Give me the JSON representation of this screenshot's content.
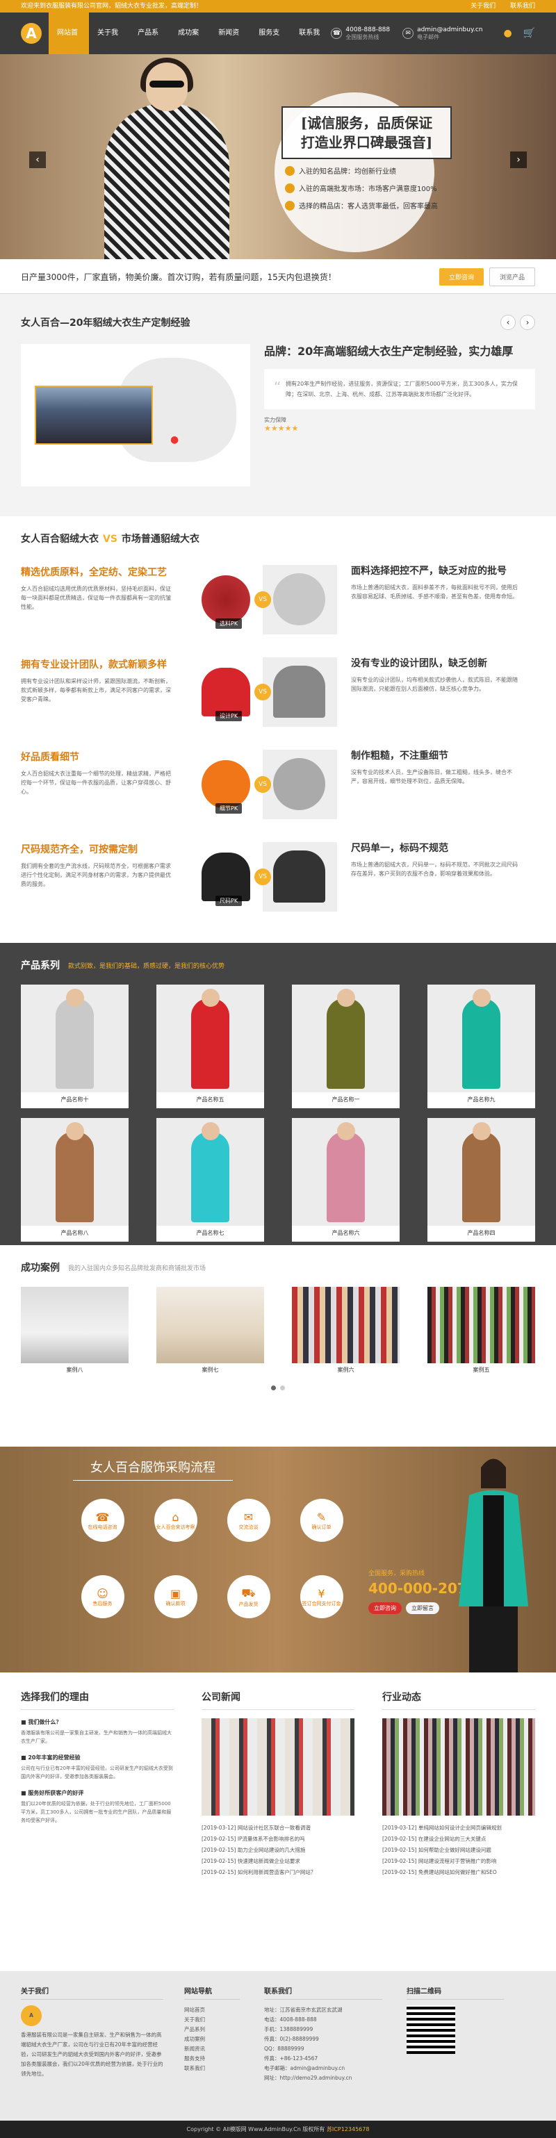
{
  "topbar": {
    "welcome": "欢迎来到衣服服装有限公司官网，貂绒大衣专业批发，高端定制！",
    "links": [
      "关于我们",
      "联系我们"
    ]
  },
  "header": {
    "logo": "A",
    "nav": [
      "网站首页",
      "关于我们",
      "产品系列",
      "成功案例",
      "新闻资讯",
      "服务支持",
      "联系我们"
    ],
    "phone": "4008-888-888",
    "phone_sub": "全国服务热线",
    "email": "admin@adminbuy.cn",
    "email_sub": "电子邮件"
  },
  "banner": {
    "slogan_line1": "[诚信服务，品质保证",
    "slogan_line2": "打造业界口碑最强音]",
    "bullets": [
      "入驻的知名品牌：均创新行业绩",
      "入驻的高端批发市场：市场客户满意度100%",
      "选择的精品店：客人选货率最低，回客率最高"
    ]
  },
  "announce": {
    "text": "日产量3000件，厂家直销，物美价廉。首次订购，若有质量问题，15天内包退换货！",
    "btn1": "立即咨询",
    "btn2": "浏览产品"
  },
  "brand": {
    "title": "女人百合—20年貂绒大衣生产定制经验",
    "heading": "品牌：20年高端貂绒大衣生产定制经验，实力雄厚",
    "quote": "拥有20年生产制作经验，进驻服务，资源保证；工厂面积5000平方米，员工300多人，实力保障；在深圳、北京、上海、杭州、成都、江苏等高端批发市场都广泛化好评。",
    "power": "实力保障",
    "stars": "★★★★★"
  },
  "compare": {
    "title_left": "女人百合貂绒大衣",
    "vs": "VS",
    "title_right": "市场普通貂绒大衣",
    "rows": [
      {
        "lh": "精选优质原料，全定纺、定染工艺",
        "lp": "女人百合貂绒均选用优质的优质原材料，坚持毛织面料，保证每一块面料都是优质精选，保证每一件衣服都具有一定的抗皱性能。",
        "tag": "选料PK",
        "rh": "面料选择把控不严，缺乏对应的批号",
        "rp": "市场上普通的貂绒大衣，面料参差不齐，每批面料批号不同，使用后衣服容易起球、毛质掉绒、手感不顺滑，甚至有色差，使用寿命短。"
      },
      {
        "lh": "拥有专业设计团队，款式新颖多样",
        "lp": "拥有专业设计团队和采样设计师，紧跟国际潮流，不断创新，款式新颖多样，每季都有新款上市，满足不同客户的需求，深受客户青睐。",
        "tag": "设计PK",
        "rh": "没有专业的设计团队，缺乏创新",
        "rp": "没有专业的设计团队，均布相关款式抄袭他人，款式陈旧，不能跟随国际潮流，只能跟在别人后面模仿，缺乏核心竞争力。"
      },
      {
        "lh": "好品质看细节",
        "lp": "女人百合貂绒大衣注重每一个细节的处理，精益求精，严格把控每一个环节，保证每一件衣服的品质，让客户穿得放心、舒心。",
        "tag": "细节PK",
        "rh": "制作粗糙，不注重细节",
        "rp": "没有专业的技术人员，生产设备陈旧，做工粗糙，线头多，缝合不严，容易开线，细节处理不到位，品质无保障。"
      },
      {
        "lh": "尺码规范齐全，可按需定制",
        "lp": "我们拥有全套的生产流水线，尺码规范齐全，可根据客户需求进行个性化定制，满足不同身材客户的需求，为客户提供最优质的服务。",
        "tag": "尺码PK",
        "rh": "尺码单一，标码不规范",
        "rp": "市场上普通的貂绒大衣，尺码单一，标码不规范，不同批次之间尺码存在差异，客户买到的衣服不合身，影响穿着效果和体验。"
      }
    ]
  },
  "products": {
    "title": "产品系列",
    "subtitle": "款式别致，是我们的基础，质感过硬，是我们的核心优势",
    "items": [
      {
        "label": "产品名称十",
        "color": "#c9c9c9",
        "accent": "#e3d322"
      },
      {
        "label": "产品名称五",
        "color": "#d8252b",
        "accent": "#d8252b"
      },
      {
        "label": "产品名称一",
        "color": "#6b6e24",
        "accent": "#6b6e24"
      },
      {
        "label": "产品名称九",
        "color": "#18b49c",
        "accent": "#18b49c"
      },
      {
        "label": "产品名称八",
        "color": "#a8714a",
        "accent": "#a8714a"
      },
      {
        "label": "产品名称七",
        "color": "#2fc6cd",
        "accent": "#2fc6cd"
      },
      {
        "label": "产品名称六",
        "color": "#d88aa1",
        "accent": "#d88aa1"
      },
      {
        "label": "产品名称四",
        "color": "#a06c44",
        "accent": "#a06c44"
      }
    ]
  },
  "cases": {
    "title": "成功案例",
    "subtitle": "我的入驻国内众多知名品牌批发商和商铺批发市场",
    "items": [
      "案例八",
      "案例七",
      "案例六",
      "案例五"
    ]
  },
  "process": {
    "title": "女人百合服饰采购流程",
    "steps": [
      {
        "icon": "☎",
        "label": "在线电话咨询"
      },
      {
        "icon": "⌂",
        "label": "女人百合来访考察"
      },
      {
        "icon": "✉",
        "label": "交流洽谈"
      },
      {
        "icon": "✎",
        "label": "确认订单"
      },
      {
        "icon": "☺",
        "label": "售后服务"
      },
      {
        "icon": "▣",
        "label": "确认款项"
      },
      {
        "icon": "⛟",
        "label": "产品发货"
      },
      {
        "icon": "¥",
        "label": "签订合同支付订金"
      }
    ],
    "hotline_label": "全国服务，采购热线",
    "hotline": "400-000-2076",
    "btn1": "立即咨询",
    "btn2": "立即留言"
  },
  "news": {
    "reason_title": "选择我们的理由",
    "reasons": [
      {
        "h": "■ 我们做什么？",
        "p": "香港服装有限公司是一家集自主研发、生产和销售为一体的高端貂绒大衣生产厂家。"
      },
      {
        "h": "■ 20年丰富的经营经验",
        "p": "公司在与行业已有20年丰富的经营经验，公司研发生产的貂绒大衣受到国内外客户的好评，受邀参加各类服装展会。"
      },
      {
        "h": "■ 服务好所获客户的好评",
        "p": "我们以20年优质的经营为依据，处于行业的领先地位，工厂面积5000平方米，员工300多人，公司拥有一批专业的生产团队，产品质量和服务均受客户好评。"
      }
    ],
    "company_title": "公司新闻",
    "company_list": [
      "[2019-03-12] 网站设计社区东联合一致看调谐",
      "[2019-02-15] IP流量体系不会影响排名的吗",
      "[2019-02-15] 助力企业网站建设的几大措施",
      "[2019-02-15] 快速建站新闻做企业站要求",
      "[2019-02-15] 如何利用新闻营造客户门户网站？"
    ],
    "industry_title": "行业动态",
    "industry_list": [
      "[2019-03-12] 单纯网站如何设计企业网页编辑规划",
      "[2019-02-15] 在建设企业网站的三大关键点",
      "[2019-02-15] 如何帮助企业做好网站建设问题",
      "[2019-02-15] 网站建设流程对于营销推广的影响",
      "[2019-02-15] 免费建站网站如何做好推广和SEO"
    ]
  },
  "footer": {
    "about_title": "关于我们",
    "about_text": "香港服装有限公司是一家集自主研发、生产和销售为一体的高端貂绒大衣生产厂家，公司在与行业已有20年丰富的经营经验，公司研发生产的貂绒大衣受到国内外客户的好评，受邀参加各类服装展会，我们以20年优质的经营为依据，处于行业的领先地位。",
    "nav_title": "网站导航",
    "nav": [
      "网站首页",
      "关于我们",
      "产品系列",
      "成功案例",
      "新闻资讯",
      "服务支持",
      "联系我们"
    ],
    "contact_title": "联系我们",
    "contact": [
      "地址：江苏省南京市玄武区玄武湖",
      "电话：4008-888-888",
      "手机：1388889999",
      "传真：0(2)-88889999",
      "QQ：88889999",
      "传真：+86-123-4567",
      "电子邮箱：admin@adminbuy.cn",
      "网址：http://demo29.adminbuy.cn"
    ],
    "qr_title": "扫描二维码"
  },
  "copyright": {
    "text": "Copyright © All模版网 Www.AdminBuy.Cn 版权所有",
    "icp": "苏ICP12345678"
  }
}
